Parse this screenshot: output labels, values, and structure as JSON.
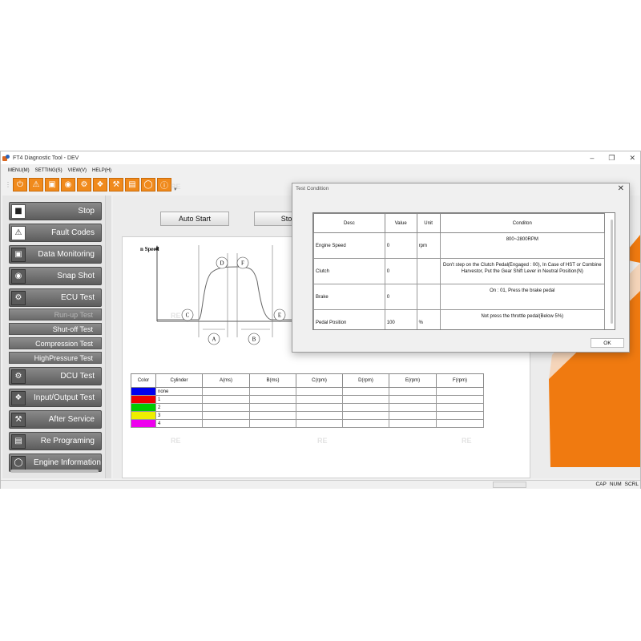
{
  "window": {
    "title": "FT4 Diagnostic Tool - DEV"
  },
  "menu": [
    "MENU(M)",
    "SETTING(S)",
    "VIEW(V)",
    "HELP(H)"
  ],
  "toolbar_icons": [
    "power-icon",
    "warning-icon",
    "monitor-icon",
    "camera-icon",
    "ecu-icon",
    "io-icon",
    "wrench-icon",
    "reprogram-icon",
    "engine-info-icon",
    "info-icon"
  ],
  "sidebar": {
    "stop": "Stop",
    "fault_codes": "Fault Codes",
    "data_monitoring": "Data Monitoring",
    "snap_shot": "Snap Shot",
    "ecu_test": "ECU Test",
    "run_up_test": "Run-up Test",
    "shut_off_test": "Shut-off Test",
    "compression_test": "Compression Test",
    "highpressure_test": "HighPressure Test",
    "dcu_test": "DCU Test",
    "io_test": "Input/Output Test",
    "after_service": "After Service",
    "re_programing": "Re Programing",
    "engine_information": "Engine Information"
  },
  "main": {
    "auto_start": "Auto Start",
    "stop": "Stop",
    "graph": {
      "ylabel": "n Speed",
      "labels": [
        "A",
        "B",
        "C",
        "D",
        "E",
        "F"
      ]
    },
    "table": {
      "headers": [
        "Color",
        "Cylinder",
        "A(ms)",
        "B(ms)",
        "C(rpm)",
        "D(rpm)",
        "E(rpm)",
        "F(rpm)"
      ],
      "rows": [
        {
          "color": "#0000ee",
          "cylinder": "none"
        },
        {
          "color": "#ee0000",
          "cylinder": "1"
        },
        {
          "color": "#00cc00",
          "cylinder": "2"
        },
        {
          "color": "#eeee00",
          "cylinder": "3"
        },
        {
          "color": "#ee00ee",
          "cylinder": "4"
        }
      ]
    }
  },
  "statusbar": [
    "CAP",
    "NUM",
    "SCRL"
  ],
  "watermark": "RE",
  "dialog": {
    "title": "Test Condition",
    "headers": [
      "Desc",
      "Value",
      "Unit",
      "Conditon"
    ],
    "rows": [
      {
        "desc": "Engine Speed",
        "value": "0",
        "unit": "rpm",
        "condition": "800~2800RPM"
      },
      {
        "desc": "Clutch",
        "value": "0",
        "unit": "",
        "condition": "Don't step on the Clutch Pedal(Engaged : 00), In Case of HST or Combine Harvestor, Put the Gear Shift Lever in Neutral Position(N)"
      },
      {
        "desc": "Brake",
        "value": "0",
        "unit": "",
        "condition": "On : 01, Press the brake pedal"
      },
      {
        "desc": "Pedal Position",
        "value": "100",
        "unit": "%",
        "condition": "Not press the throttle pedal(Below 5%)"
      }
    ],
    "ok": "OK"
  },
  "colors": {
    "accent": "#f08a1c",
    "deco_orange": "#f07a10"
  }
}
